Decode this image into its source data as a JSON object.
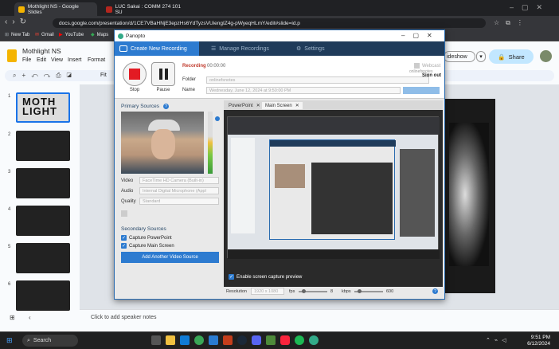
{
  "browser": {
    "tabs": [
      {
        "title": "Mothlight NS - Google Slides",
        "color": "#f4b400",
        "active": true
      },
      {
        "title": "LUC Sakai : COMM 274 101 SU",
        "color": "#b3261e",
        "active": false
      }
    ],
    "url": "docs.google.com/presentation/d/1CE7VBaHNjE3epzHs6YdTyzsVUiengIZ4g-pWyeqHLmY/edit#slide=id.p",
    "bookmarks": [
      "New Tab",
      "Gmail",
      "YouTube",
      "Maps"
    ]
  },
  "slides": {
    "title": "Mothlight NS",
    "menu": [
      "File",
      "Edit",
      "View",
      "Insert",
      "Format",
      "Sl"
    ],
    "toolbar_fit": "Fit",
    "slideshow_label": "ideshow",
    "share_label": "Share",
    "thumb_numbers": [
      "1",
      "2",
      "3",
      "4",
      "5",
      "6"
    ],
    "notes_placeholder": "Click to add speaker notes"
  },
  "panopto": {
    "app_name": "Panopto",
    "tabs": [
      "Create New Recording",
      "Manage Recordings",
      "Settings"
    ],
    "recording_label": "Recording",
    "recording_time": "00:00:00",
    "pause_label_right": "Webcast",
    "signout": "Sign out",
    "user": "onlinefsnotes",
    "stop_label": "Stop",
    "pause_label": "Pause",
    "folder_label": "Folder",
    "folder_value": "onlinefsnotes",
    "name_label": "Name",
    "name_value": "Wednesday, June 12, 2024 at 9:50:00 PM",
    "primary_sources": "Primary Sources",
    "video_label": "Video",
    "video_value": "FaceTime HD Camera (Built-in)",
    "audio_label": "Audio",
    "audio_value": "Internal Digital Microphone (Appl",
    "quality_label": "Quality",
    "quality_value": "Standard",
    "secondary_sources": "Secondary Sources",
    "capture_pp": "Capture PowerPoint",
    "capture_main": "Capture Main Screen",
    "add_video": "Add Another Video Source",
    "screen_tabs": [
      "PowerPoint",
      "Main Screen"
    ],
    "enable_preview": "Enable screen capture preview",
    "resolution_label": "Resolution",
    "resolution_value": "1920 x 1080",
    "fps_label": "fps",
    "fps_value": "8",
    "kbps_label": "kbps",
    "kbps_value": "600"
  },
  "taskbar": {
    "search": "Search",
    "time": "9:51 PM",
    "date": "6/12/2024"
  }
}
